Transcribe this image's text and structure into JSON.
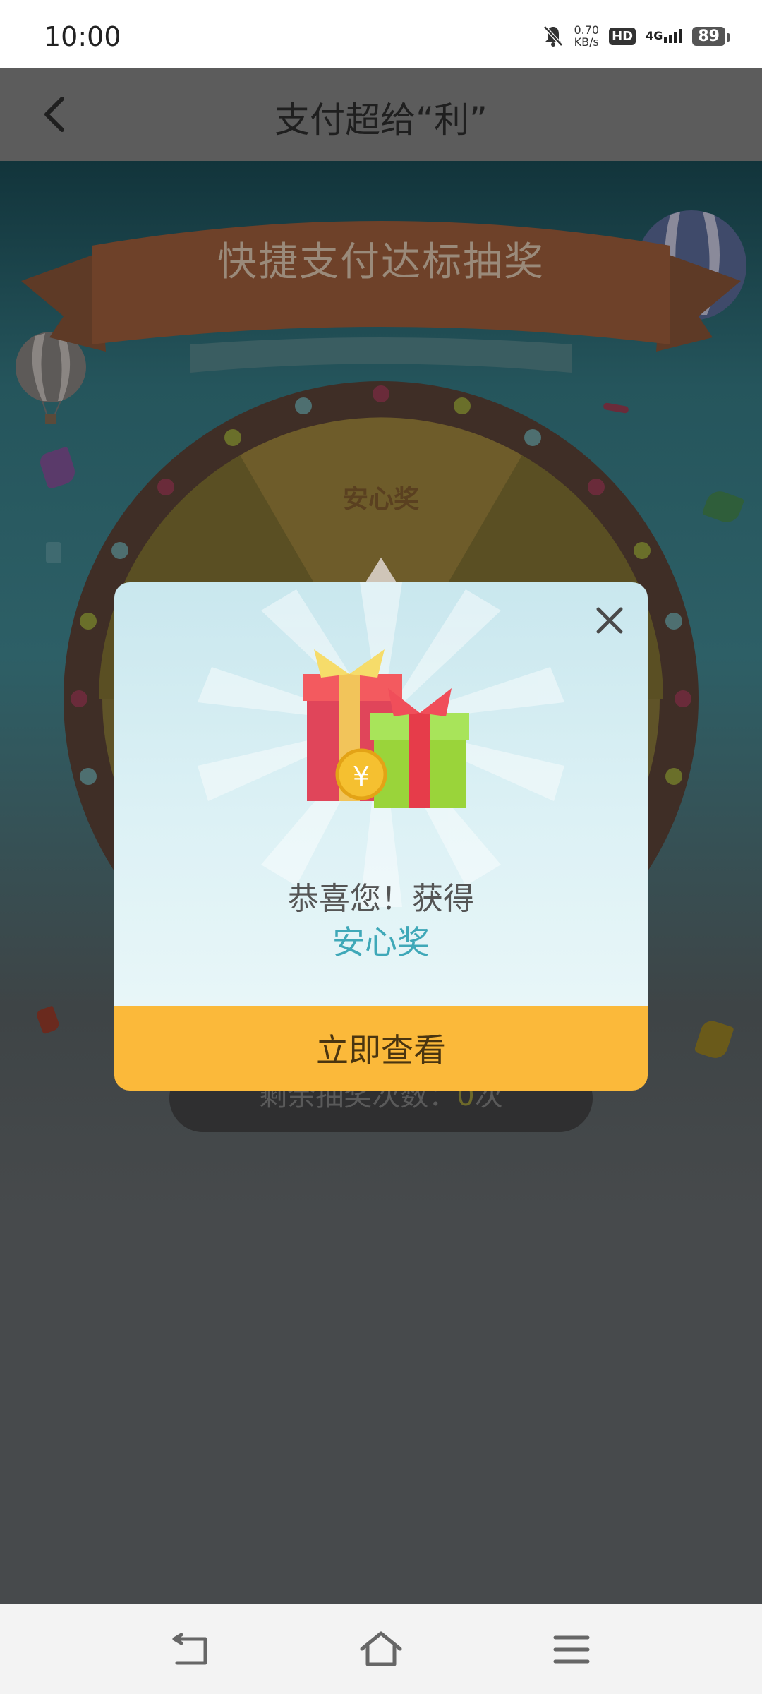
{
  "status_bar": {
    "time": "10:00",
    "net_speed_value": "0.70",
    "net_speed_unit": "KB/s",
    "hd": "HD",
    "network": "4G",
    "battery": "89",
    "icons": [
      "bell-muted-icon",
      "hd-icon",
      "signal-icon",
      "battery-icon"
    ]
  },
  "header": {
    "title": "支付超给“利”",
    "back_icon": "chevron-left-icon"
  },
  "game": {
    "banner_title": "快捷支付达标抽奖",
    "wheel_prize_label": "安心奖",
    "remaining_label": "剩余抽奖次数：",
    "remaining_count": "0",
    "remaining_unit": "次"
  },
  "modal": {
    "congrats_text": "恭喜您！获得",
    "prize_name": "安心奖",
    "view_button": "立即查看",
    "close_icon": "close-icon",
    "illustration": "gift-boxes-with-coin"
  },
  "nav_bar": {
    "icons": [
      "back-nav-icon",
      "home-icon",
      "menu-icon"
    ]
  },
  "colors": {
    "accent_yellow": "#fbb93a",
    "prize_text": "#3fa8b8",
    "overlay": "#474a4c"
  }
}
